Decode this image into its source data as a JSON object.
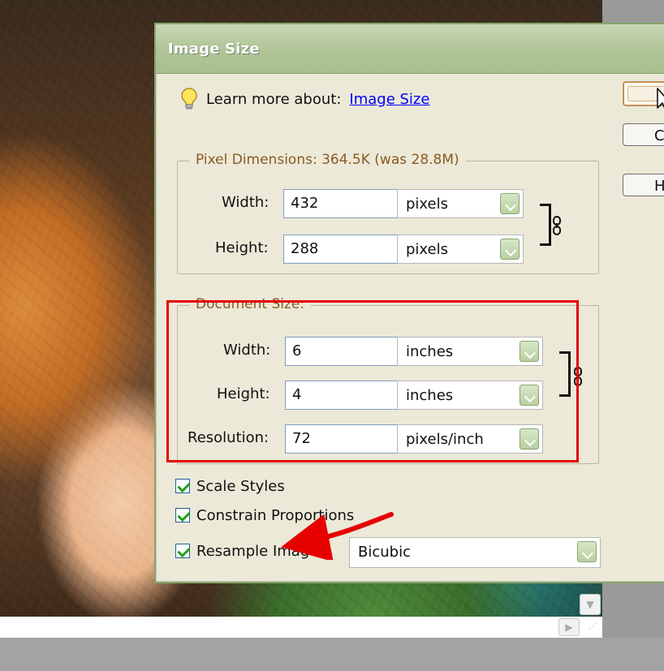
{
  "dialog": {
    "title": "Image Size",
    "learn_more_text": "Learn more about:",
    "learn_more_link": "Image Size",
    "side_buttons": {
      "cancel_partial": "Ca",
      "help_partial": "H"
    }
  },
  "pixel_dimensions": {
    "title": "Pixel Dimensions:  364.5K (was 28.8M)",
    "width_label": "Width:",
    "width_value": "432",
    "width_unit": "pixels",
    "height_label": "Height:",
    "height_value": "288",
    "height_unit": "pixels"
  },
  "document_size": {
    "title": "Document Size:",
    "width_label": "Width:",
    "width_value": "6",
    "width_unit": "inches",
    "height_label": "Height:",
    "height_value": "4",
    "height_unit": "inches",
    "resolution_label": "Resolution:",
    "resolution_value": "72",
    "resolution_unit": "pixels/inch"
  },
  "options": {
    "scale_styles": "Scale Styles",
    "constrain_proportions": "Constrain Proportions",
    "resample_image": "Resample Image:",
    "resample_method": "Bicubic"
  },
  "colors": {
    "highlight": "#e60000",
    "titlebar": "#a7bf8e",
    "link": "#0000ff"
  },
  "icons": {
    "lightbulb": "lightbulb-icon",
    "chain_link": "chain-link-icon",
    "dropdown_chevron": "chevron-down-icon",
    "cursor": "mouse-pointer-icon",
    "annotation_arrow": "red-arrow-annotation"
  }
}
